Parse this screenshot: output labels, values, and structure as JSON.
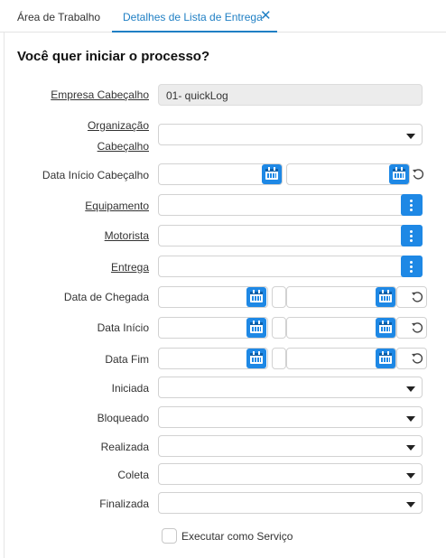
{
  "tabs": [
    {
      "label": "Área de Trabalho"
    },
    {
      "label": "Detalhes de Lista de Entrega"
    }
  ],
  "tab_close_glyph": "✕",
  "dialog_title": "Você quer iniciar o processo?",
  "fields": {
    "empresa": {
      "label": "Empresa Cabeçalho",
      "value": "01- quickLog"
    },
    "organizacao": {
      "label_line1": "Organização",
      "label_line2": "Cabeçalho",
      "value": ""
    },
    "data_inicio_cabecalho": {
      "label": "Data Início Cabeçalho"
    },
    "equipamento": {
      "label": "Equipamento"
    },
    "motorista": {
      "label": "Motorista"
    },
    "entrega": {
      "label": "Entrega"
    },
    "data_chegada": {
      "label": "Data de Chegada"
    },
    "data_inicio": {
      "label": "Data Início"
    },
    "data_fim": {
      "label": "Data Fim"
    },
    "iniciada": {
      "label": "Iniciada",
      "value": ""
    },
    "bloqueado": {
      "label": "Bloqueado",
      "value": ""
    },
    "realizada": {
      "label": "Realizada",
      "value": ""
    },
    "coleta": {
      "label": "Coleta",
      "value": ""
    },
    "finalizada": {
      "label": "Finalizada",
      "value": ""
    }
  },
  "executar_servico": {
    "label": "Executar como Serviço",
    "checked": false
  },
  "colors": {
    "accent": "#1e88e5",
    "tab_active": "#1f7fc4",
    "readonly_bg": "#ececec"
  },
  "icons": [
    "close-icon",
    "chevron-down-icon",
    "more-vertical-icon",
    "calendar-icon",
    "reset-icon"
  ]
}
